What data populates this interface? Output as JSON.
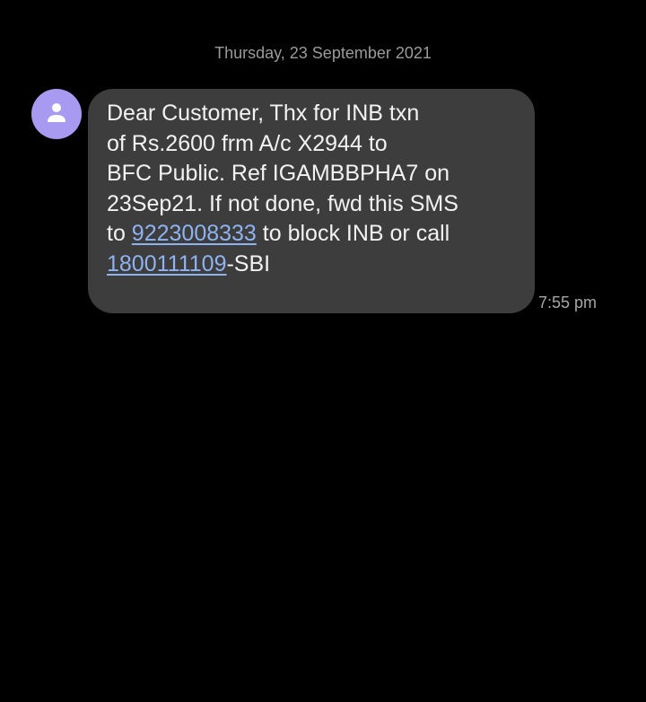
{
  "conversation": {
    "date_header": "Thursday, 23 September 2021"
  },
  "message": {
    "avatar_icon": "person-icon",
    "line1": "Dear Customer, Thx for INB txn",
    "line2": "of Rs.2600 frm A/c X2944 to",
    "line3": "BFC Public. Ref IGAMBBPHA7 on",
    "line4": "23Sep21. If not done, fwd this SMS",
    "line5_prefix": "to ",
    "phone_link_1": "9223008333",
    "line5_suffix": " to block INB or call",
    "phone_link_2": "1800111109",
    "line6_suffix": "-SBI",
    "timestamp": "7:55 pm"
  },
  "colors": {
    "background": "#000000",
    "bubble": "#3d3d3d",
    "avatar": "#a79af0",
    "link": "#8fb3f0",
    "secondary_text": "#9a9a9a"
  }
}
